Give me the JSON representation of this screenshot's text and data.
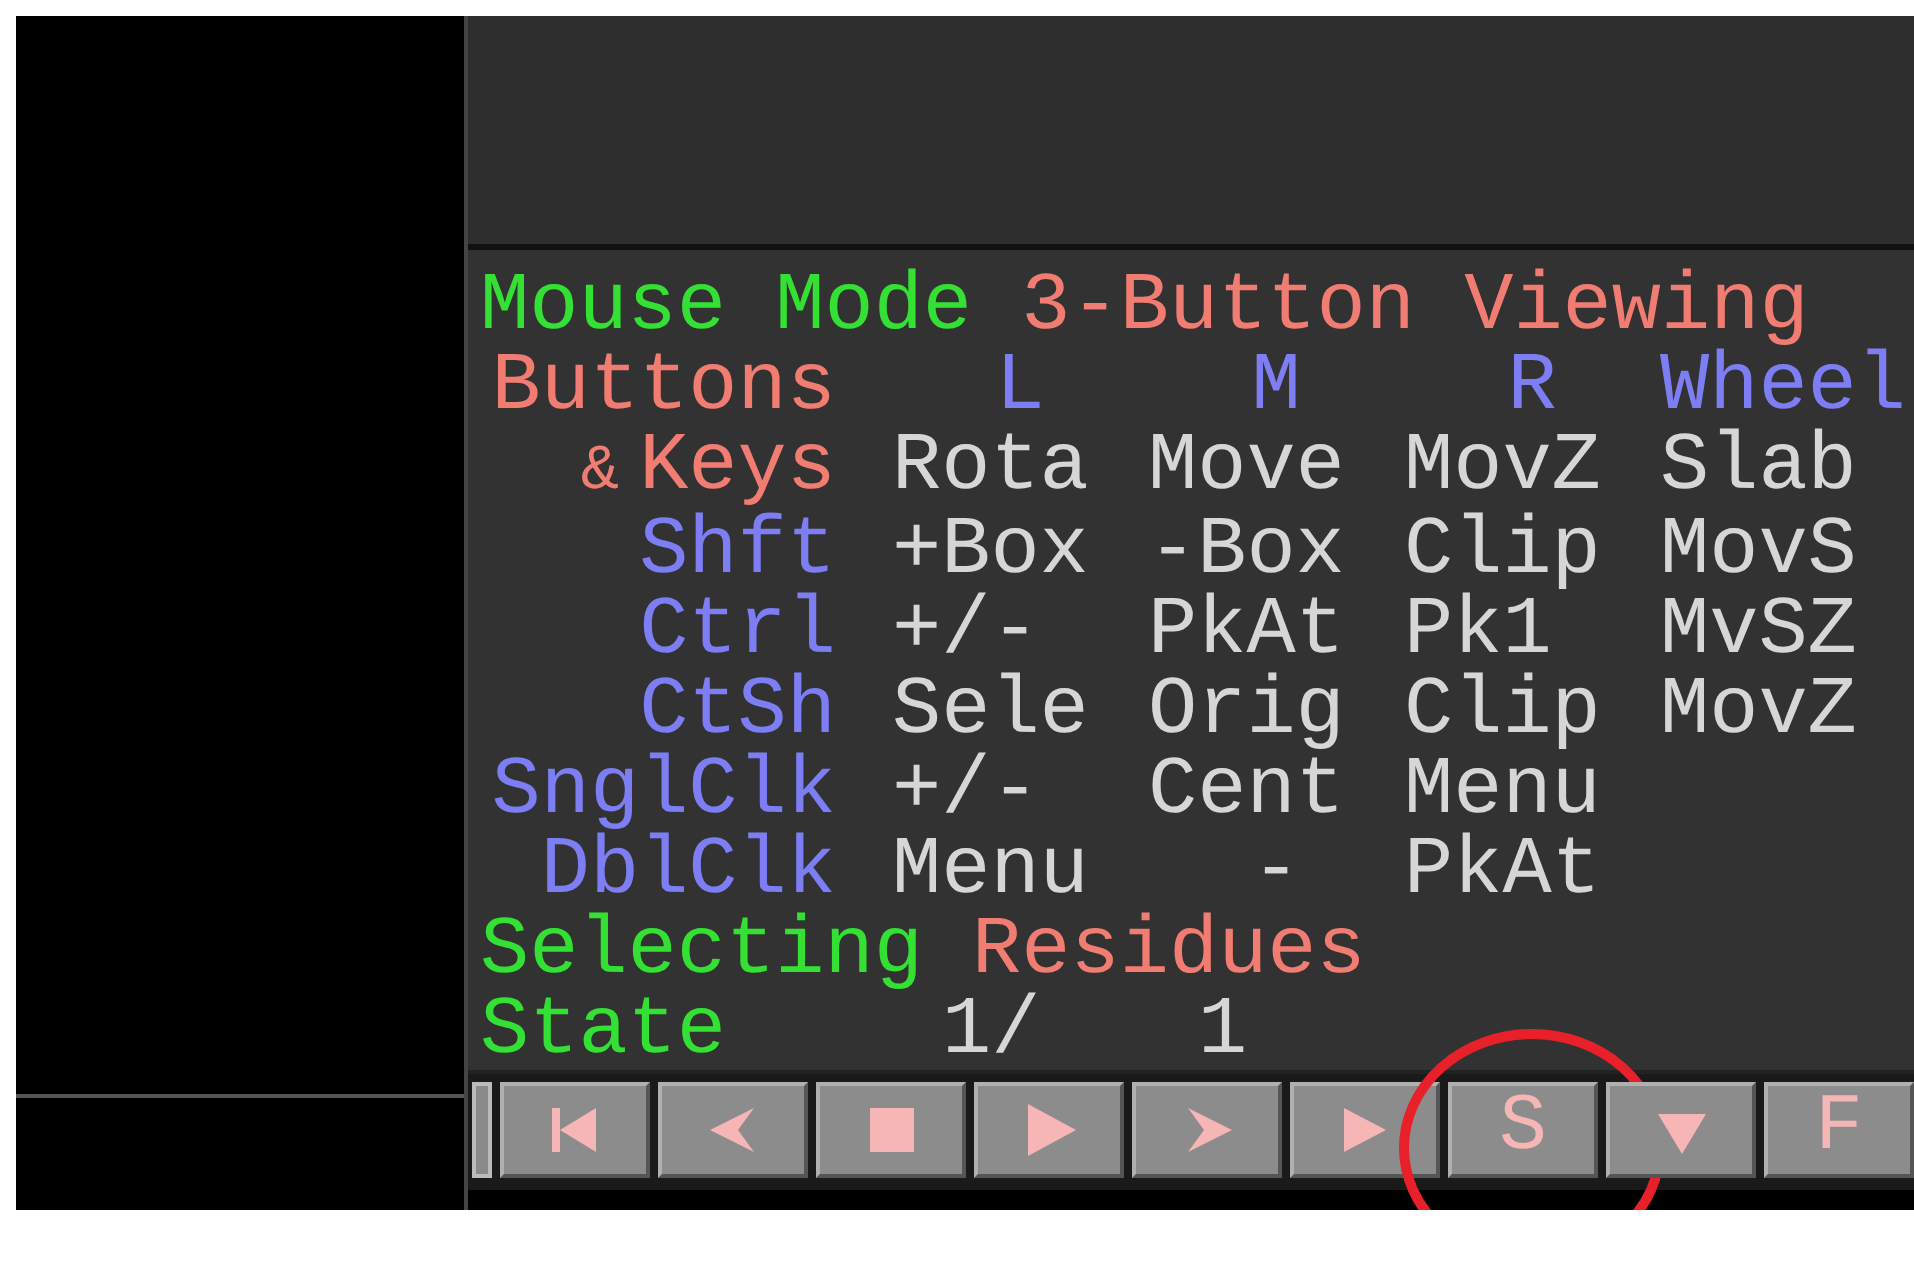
{
  "mouse_mode": {
    "label": "Mouse Mode",
    "value": "3-Button Viewing"
  },
  "header": {
    "label": "Buttons",
    "buttons": [
      "L",
      "M",
      "R",
      "Wheel"
    ]
  },
  "bindings": [
    {
      "prefix": "&",
      "key": "Keys",
      "color": "#f07c72",
      "actions": [
        "Rota",
        "Move",
        "MovZ",
        "Slab"
      ]
    },
    {
      "key": "Shft",
      "color": "#7d7df4",
      "actions": [
        "+Box",
        "-Box",
        "Clip",
        "MovS"
      ]
    },
    {
      "key": "Ctrl",
      "color": "#7d7df4",
      "actions": [
        "+/-",
        "PkAt",
        "Pk1",
        "MvSZ"
      ]
    },
    {
      "key": "CtSh",
      "color": "#7d7df4",
      "actions": [
        "Sele",
        "Orig",
        "Clip",
        "MovZ"
      ]
    },
    {
      "key": "SnglClk",
      "color": "#7d7df4",
      "actions": [
        "+/-",
        "Cent",
        "Menu"
      ]
    },
    {
      "key": "DblClk",
      "color": "#7d7df4",
      "actions": [
        "Menu",
        "-",
        "PkAt"
      ]
    }
  ],
  "selecting": {
    "label": "Selecting",
    "value": "Residues"
  },
  "state": {
    "label": "State",
    "current": "1/",
    "total": "1"
  },
  "buttons": [
    {
      "kind": "rewind",
      "highlighted": false
    },
    {
      "kind": "back",
      "highlighted": false
    },
    {
      "kind": "stop",
      "highlighted": false
    },
    {
      "kind": "play",
      "highlighted": false
    },
    {
      "kind": "forward",
      "highlighted": false
    },
    {
      "kind": "end",
      "highlighted": false
    },
    {
      "kind": "text",
      "label": "S",
      "highlighted": true
    },
    {
      "kind": "dropdown",
      "highlighted": false
    },
    {
      "kind": "text",
      "label": "F",
      "highlighted": false
    }
  ]
}
